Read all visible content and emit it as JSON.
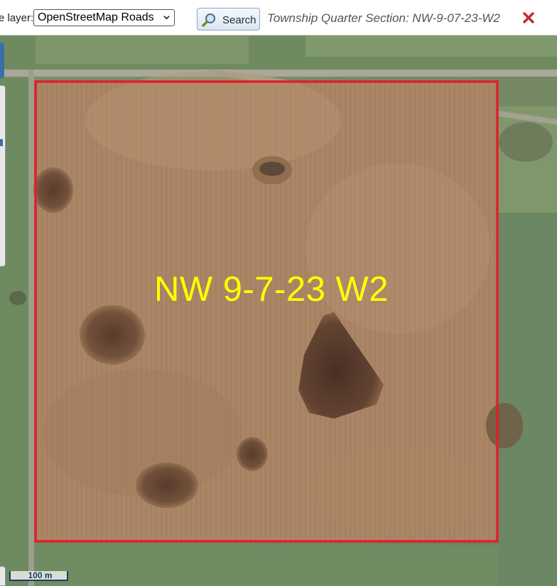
{
  "toolbar": {
    "layer_label": "e layer:",
    "layer_select_value": "OpenStreetMap Roads",
    "search_label": "Search",
    "title": "Township Quarter Section: NW-9-07-23-W2"
  },
  "map": {
    "parcel_label": "NW 9-7-23 W2",
    "scale_label": "100 m",
    "parcel_outline_color": "#e0202a",
    "label_color": "#ffff00"
  },
  "icons": {
    "search": "magnifier-icon",
    "close": "close-x-icon",
    "dropdown": "chevron-down-icon"
  }
}
